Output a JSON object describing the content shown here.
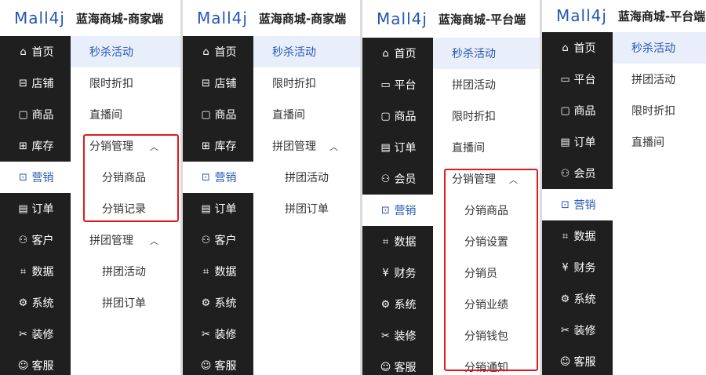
{
  "panels": [
    {
      "logo": "Mall4j",
      "brand": "蓝海商城-商家端",
      "sidebar": [
        {
          "label": "首页",
          "icon": "home-icon",
          "glyph": "⌂"
        },
        {
          "label": "店铺",
          "icon": "store-icon",
          "glyph": "⊟"
        },
        {
          "label": "商品",
          "icon": "product-icon",
          "glyph": "▢"
        },
        {
          "label": "库存",
          "icon": "stock-icon",
          "glyph": "⊞"
        },
        {
          "label": "营销",
          "icon": "gift-icon",
          "glyph": "⊡",
          "active": true
        },
        {
          "label": "订单",
          "icon": "order-icon",
          "glyph": "▤"
        },
        {
          "label": "客户",
          "icon": "customer-icon",
          "glyph": "⚇"
        },
        {
          "label": "数据",
          "icon": "data-icon",
          "glyph": "⌗"
        },
        {
          "label": "系统",
          "icon": "settings-icon",
          "glyph": "⚙"
        },
        {
          "label": "装修",
          "icon": "decorate-icon",
          "glyph": "✂"
        },
        {
          "label": "客服",
          "icon": "chat-icon",
          "glyph": "☺"
        }
      ],
      "submenu": [
        {
          "label": "秒杀活动",
          "sel": true
        },
        {
          "label": "限时折扣"
        },
        {
          "label": "直播间"
        },
        {
          "label": "分销管理",
          "group": true,
          "chevron": "︿"
        },
        {
          "label": "分销商品",
          "child": true
        },
        {
          "label": "分销记录",
          "child": true
        },
        {
          "label": "拼团管理",
          "group": true,
          "chevron": "︿"
        },
        {
          "label": "拼团活动",
          "child": true
        },
        {
          "label": "拼团订单",
          "child": true
        }
      ]
    },
    {
      "logo": "Mall4j",
      "brand": "蓝海商城-商家端",
      "sidebar": [
        {
          "label": "首页",
          "icon": "home-icon",
          "glyph": "⌂"
        },
        {
          "label": "店铺",
          "icon": "store-icon",
          "glyph": "⊟"
        },
        {
          "label": "商品",
          "icon": "product-icon",
          "glyph": "▢"
        },
        {
          "label": "库存",
          "icon": "stock-icon",
          "glyph": "⊞"
        },
        {
          "label": "营销",
          "icon": "gift-icon",
          "glyph": "⊡",
          "active": true
        },
        {
          "label": "订单",
          "icon": "order-icon",
          "glyph": "▤"
        },
        {
          "label": "客户",
          "icon": "customer-icon",
          "glyph": "⚇"
        },
        {
          "label": "数据",
          "icon": "data-icon",
          "glyph": "⌗"
        },
        {
          "label": "系统",
          "icon": "settings-icon",
          "glyph": "⚙"
        },
        {
          "label": "装修",
          "icon": "decorate-icon",
          "glyph": "✂"
        },
        {
          "label": "客服",
          "icon": "chat-icon",
          "glyph": "☺"
        }
      ],
      "submenu": [
        {
          "label": "秒杀活动",
          "sel": true
        },
        {
          "label": "限时折扣"
        },
        {
          "label": "直播间"
        },
        {
          "label": "拼团管理",
          "group": true,
          "chevron": "︿"
        },
        {
          "label": "拼团活动",
          "child": true
        },
        {
          "label": "拼团订单",
          "child": true
        }
      ]
    },
    {
      "logo": "Mall4j",
      "brand": "蓝海商城-平台端",
      "sidebar": [
        {
          "label": "首页",
          "icon": "home-icon",
          "glyph": "⌂"
        },
        {
          "label": "平台",
          "icon": "platform-icon",
          "glyph": "▭"
        },
        {
          "label": "商品",
          "icon": "product-icon",
          "glyph": "▢"
        },
        {
          "label": "订单",
          "icon": "order-icon",
          "glyph": "▤"
        },
        {
          "label": "会员",
          "icon": "member-icon",
          "glyph": "⚇"
        },
        {
          "label": "营销",
          "icon": "gift-icon",
          "glyph": "⊡",
          "active": true
        },
        {
          "label": "数据",
          "icon": "data-icon",
          "glyph": "⌗"
        },
        {
          "label": "财务",
          "icon": "finance-icon",
          "glyph": "¥"
        },
        {
          "label": "系统",
          "icon": "settings-icon",
          "glyph": "⚙"
        },
        {
          "label": "装修",
          "icon": "decorate-icon",
          "glyph": "✂"
        },
        {
          "label": "客服",
          "icon": "chat-icon",
          "glyph": "☺"
        }
      ],
      "submenu": [
        {
          "label": "秒杀活动",
          "sel": true
        },
        {
          "label": "拼团活动"
        },
        {
          "label": "限时折扣"
        },
        {
          "label": "直播间"
        },
        {
          "label": "分销管理",
          "group": true,
          "chevron": "︿"
        },
        {
          "label": "分销商品",
          "child": true
        },
        {
          "label": "分销设置",
          "child": true
        },
        {
          "label": "分销员",
          "child": true
        },
        {
          "label": "分销业绩",
          "child": true
        },
        {
          "label": "分销钱包",
          "child": true
        },
        {
          "label": "分销通知",
          "child": true
        }
      ]
    },
    {
      "logo": "Mall4j",
      "brand": "蓝海商城-平台端",
      "sidebar": [
        {
          "label": "首页",
          "icon": "home-icon",
          "glyph": "⌂"
        },
        {
          "label": "平台",
          "icon": "platform-icon",
          "glyph": "▭"
        },
        {
          "label": "商品",
          "icon": "product-icon",
          "glyph": "▢"
        },
        {
          "label": "订单",
          "icon": "order-icon",
          "glyph": "▤"
        },
        {
          "label": "会员",
          "icon": "member-icon",
          "glyph": "⚇"
        },
        {
          "label": "营销",
          "icon": "gift-icon",
          "glyph": "⊡",
          "active": true
        },
        {
          "label": "数据",
          "icon": "data-icon",
          "glyph": "⌗"
        },
        {
          "label": "财务",
          "icon": "finance-icon",
          "glyph": "¥"
        },
        {
          "label": "系统",
          "icon": "settings-icon",
          "glyph": "⚙"
        },
        {
          "label": "装修",
          "icon": "decorate-icon",
          "glyph": "✂"
        },
        {
          "label": "客服",
          "icon": "chat-icon",
          "glyph": "☺"
        }
      ],
      "submenu": [
        {
          "label": "秒杀活动",
          "sel": true
        },
        {
          "label": "拼团活动"
        },
        {
          "label": "限时折扣"
        },
        {
          "label": "直播间"
        }
      ]
    }
  ]
}
